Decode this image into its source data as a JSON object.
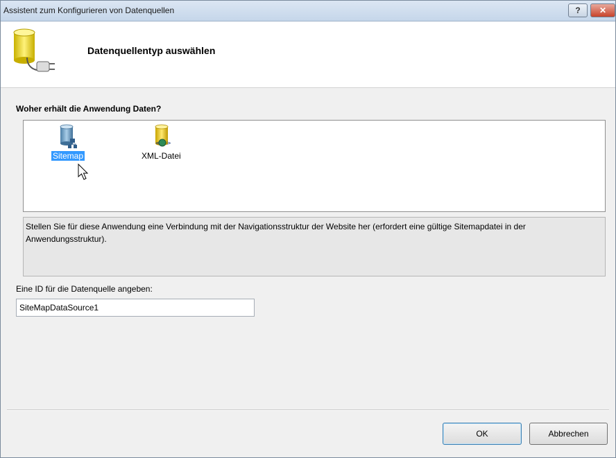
{
  "window": {
    "title": "Assistent zum Konfigurieren von Datenquellen",
    "help_label": "?",
    "close_label": "✕"
  },
  "header": {
    "title": "Datenquellentyp auswählen",
    "icon": "database-plug-icon"
  },
  "sources": {
    "question": "Woher erhält die Anwendung Daten?",
    "items": [
      {
        "label": "Sitemap",
        "icon": "sitemap-database-icon",
        "selected": true
      },
      {
        "label": "XML-Datei",
        "icon": "xml-database-icon",
        "selected": false
      }
    ]
  },
  "description": "Stellen Sie für diese Anwendung eine Verbindung mit der Navigationsstruktur der Website her (erfordert eine gültige Sitemapdatei in der Anwendungsstruktur).",
  "id_field": {
    "label": "Eine ID für die Datenquelle angeben:",
    "value": "SiteMapDataSource1"
  },
  "buttons": {
    "ok": "OK",
    "cancel": "Abbrechen"
  },
  "colors": {
    "selection": "#3399ff",
    "titlebar": "#c5d6ea"
  }
}
